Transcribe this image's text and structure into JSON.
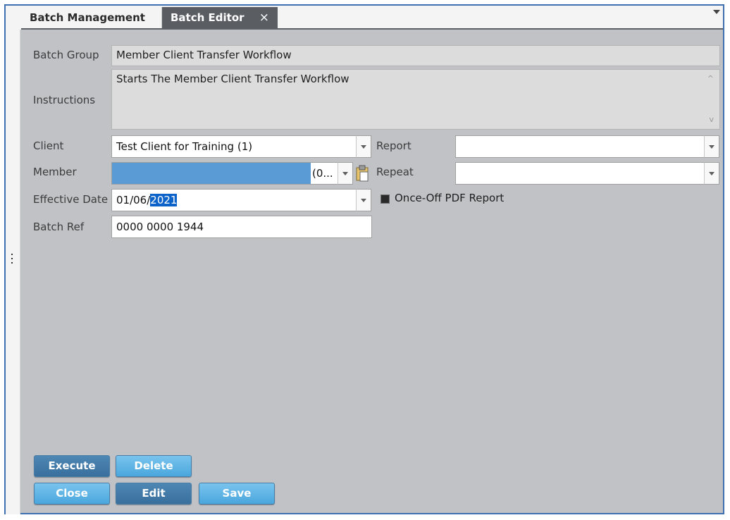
{
  "tabs": [
    {
      "label": "Batch Management",
      "active": false
    },
    {
      "label": "Batch Editor",
      "active": true,
      "close": "×"
    }
  ],
  "form": {
    "batch_group_label": "Batch Group",
    "batch_group_value": "Member Client Transfer Workflow",
    "instructions_label": "Instructions",
    "instructions_value": "Starts The Member Client Transfer Workflow",
    "client_label": "Client",
    "client_value": "Test Client for Training (1)",
    "member_label": "Member",
    "member_value_suffix": "(0...",
    "effective_date_label": "Effective Date",
    "effective_date_prefix": "01/06/",
    "effective_date_selected": "2021",
    "batch_ref_label": "Batch Ref",
    "batch_ref_value": "0000 0000 1944",
    "report_label": "Report",
    "report_value": "",
    "repeat_label": "Repeat",
    "repeat_value": "",
    "once_off_label": "Once-Off PDF Report"
  },
  "buttons": {
    "execute": "Execute",
    "delete": "Delete",
    "close": "Close",
    "edit": "Edit",
    "save": "Save"
  },
  "colors": {
    "accent_light_button": "#5ab3e6",
    "accent_dark_button": "#3f77a5",
    "panel_background": "#c0c2c6",
    "selection": "#0b63c9"
  }
}
